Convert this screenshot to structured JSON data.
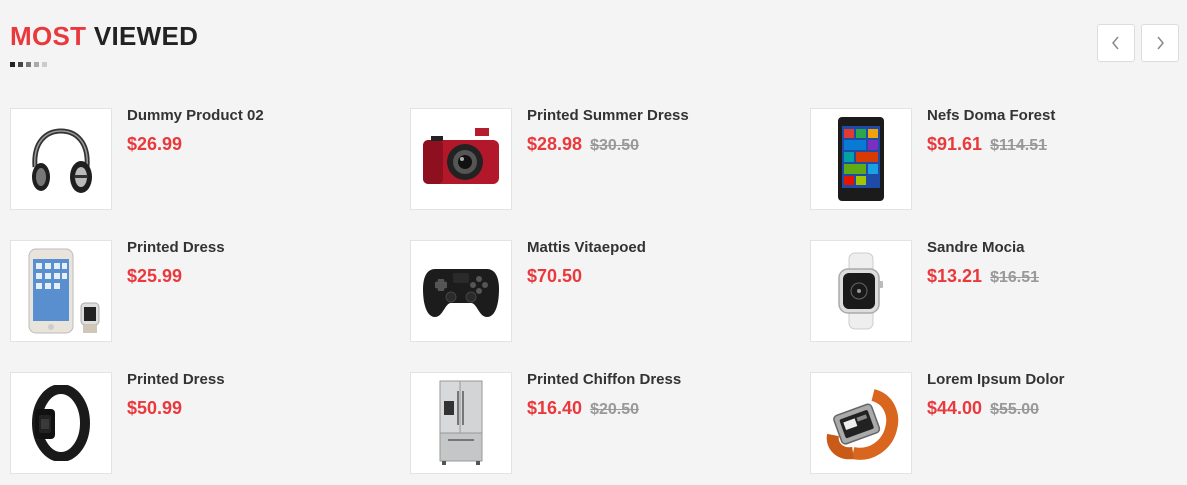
{
  "section": {
    "title_accent": "MOST",
    "title_rest": "VIEWED",
    "accent_color": "#e9393c"
  },
  "nav": {
    "prev_icon": "chevron-left-icon",
    "next_icon": "chevron-right-icon"
  },
  "products": [
    {
      "name": "Dummy Product 02",
      "price": "$26.99",
      "old_price": "",
      "icon": "headphones-icon"
    },
    {
      "name": "Printed Summer Dress",
      "price": "$28.98",
      "old_price": "$30.50",
      "icon": "camera-icon"
    },
    {
      "name": "Nefs Doma Forest",
      "price": "$91.61",
      "old_price": "$114.51",
      "icon": "smartphone-icon"
    },
    {
      "name": "Printed Dress",
      "price": "$25.99",
      "old_price": "",
      "icon": "phone-and-watch-icon"
    },
    {
      "name": "Mattis Vitaepoed",
      "price": "$70.50",
      "old_price": "",
      "icon": "gamepad-icon"
    },
    {
      "name": "Sandre Mocia",
      "price": "$13.21",
      "old_price": "$16.51",
      "icon": "smartwatch-icon"
    },
    {
      "name": "Printed Dress",
      "price": "$50.99",
      "old_price": "",
      "icon": "fitness-band-icon"
    },
    {
      "name": "Printed Chiffon Dress",
      "price": "$16.40",
      "old_price": "$20.50",
      "icon": "refrigerator-icon"
    },
    {
      "name": "Lorem Ipsum Dolor",
      "price": "$44.00",
      "old_price": "$55.00",
      "icon": "wrist-watch-icon"
    }
  ]
}
